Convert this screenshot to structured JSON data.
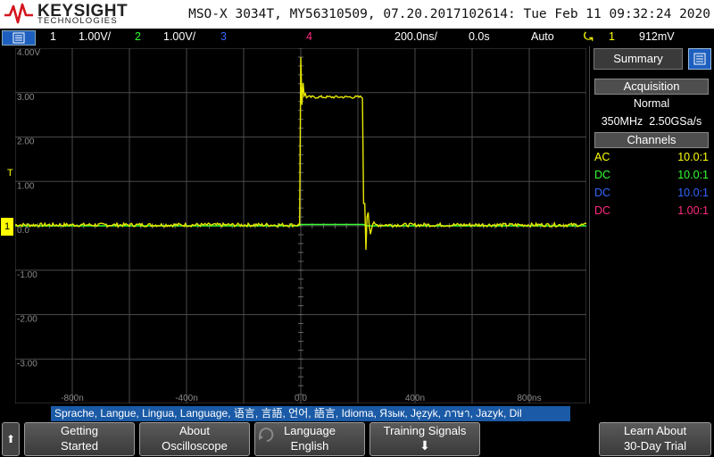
{
  "header": {
    "brand": "KEYSIGHT",
    "brand_sub": "TECHNOLOGIES",
    "instrument": "MSO-X 3034T, MY56310509, 07.20.2017102614: Tue Feb 11 09:32:24 2020"
  },
  "channel_bar": {
    "ch1_num": "1",
    "ch1_scale": "1.00V/",
    "ch2_num": "2",
    "ch2_scale": "1.00V/",
    "ch3_num": "3",
    "ch4_num": "4",
    "timebase": "200.0ns/",
    "delay": "0.0s",
    "trigger_mode": "Auto",
    "trigger_channel": "1",
    "trigger_level": "912mV"
  },
  "grid": {
    "y_labels": [
      "4.00V",
      "3.00",
      "2.00",
      "1.00",
      "0.0",
      "-1.00",
      "-2.00",
      "-3.00"
    ],
    "x_labels": [
      "-800n",
      "-400n",
      "0.0",
      "400n",
      "800ns"
    ],
    "trig_marker": "T",
    "ch1_marker": "1"
  },
  "panel": {
    "summary": "Summary",
    "acquisition_header": "Acquisition",
    "acq_mode": "Normal",
    "bandwidth": "350MHz",
    "sample_rate": "2.50GSa/s",
    "channels_header": "Channels",
    "channels": [
      {
        "coupling": "AC",
        "probe": "10.0:1",
        "color": "#ffff00"
      },
      {
        "coupling": "DC",
        "probe": "10.0:1",
        "color": "#33ff33"
      },
      {
        "coupling": "DC",
        "probe": "10.0:1",
        "color": "#3366ff"
      },
      {
        "coupling": "DC",
        "probe": "1.00:1",
        "color": "#ff2a7f"
      }
    ]
  },
  "language_banner": "Sprache, Langue, Lingua, Language, 语言, 言語, 언어, 語言, Idioma, Язык, Język, ภาษา, Jazyk, Dil",
  "softkeys": {
    "getting_started_1": "Getting",
    "getting_started_2": "Started",
    "about_1": "About",
    "about_2": "Oscilloscope",
    "language_1": "Language",
    "language_2": "English",
    "training_1": "Training Signals",
    "learn_1": "Learn About",
    "learn_2": "30-Day Trial"
  },
  "colors": {
    "ch1": "#ffff00",
    "ch2": "#33ff33",
    "ch3": "#3366ff",
    "ch4": "#ff2a7f",
    "accent": "#1d5fbf"
  }
}
